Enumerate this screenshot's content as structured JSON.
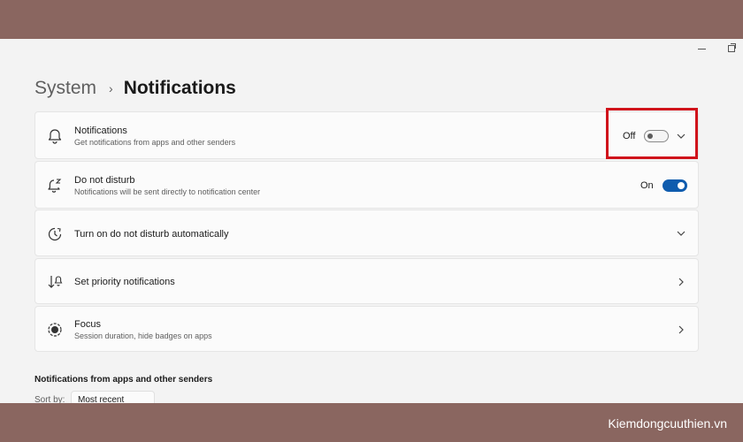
{
  "breadcrumb": {
    "parent": "System",
    "separator": "›",
    "current": "Notifications"
  },
  "settings": [
    {
      "title": "Notifications",
      "subtitle": "Get notifications from apps and other senders",
      "state": "Off",
      "toggle_on": false,
      "icon": "bell-icon",
      "chevron": "down"
    },
    {
      "title": "Do not disturb",
      "subtitle": "Notifications will be sent directly to notification center",
      "state": "On",
      "toggle_on": true,
      "icon": "bell-snooze-icon"
    },
    {
      "title": "Turn on do not disturb automatically",
      "icon": "clock-icon",
      "chevron": "down"
    },
    {
      "title": "Set priority notifications",
      "icon": "priority-icon",
      "chevron": "right"
    },
    {
      "title": "Focus",
      "subtitle": "Session duration, hide badges on apps",
      "icon": "focus-icon",
      "chevron": "right"
    }
  ],
  "section": {
    "title": "Notifications from apps and other senders",
    "sort_label": "Sort by:",
    "sort_value": "Most recent"
  },
  "watermark": "Kiemdongcuuthien.vn",
  "colors": {
    "accent": "#0f5cae",
    "highlight": "#d0131b",
    "frame": "#8a6660"
  }
}
